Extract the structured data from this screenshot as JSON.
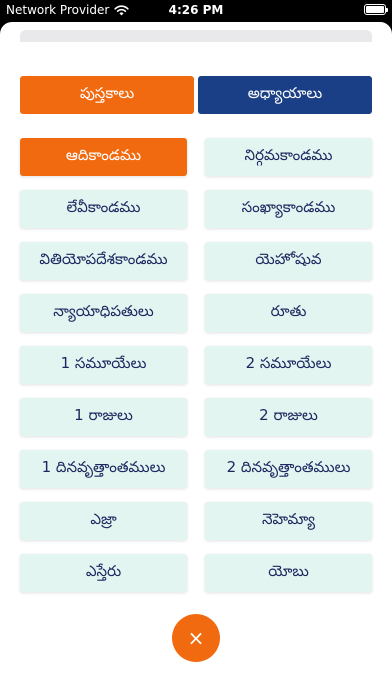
{
  "status_bar": {
    "carrier": "Network Provider",
    "time": "4:26 PM",
    "wifi_icon": "wifi-icon",
    "battery_icon": "battery-icon",
    "battery_level": 1.0
  },
  "tabs": {
    "books_label": "పుస్తకాలు",
    "chapters_label": "అధ్యాయాలు",
    "active": "books"
  },
  "books": [
    {
      "name": "ఆదికాండము",
      "selected": true
    },
    {
      "name": "నిర్గమకాండము",
      "selected": false
    },
    {
      "name": "లేవీకాండము",
      "selected": false
    },
    {
      "name": "సంఖ్యాకాండము",
      "selected": false
    },
    {
      "name": "వితియోపదేశకాండము",
      "selected": false
    },
    {
      "name": "యెహోషువ",
      "selected": false
    },
    {
      "name": "న్యాయాధిపతులు",
      "selected": false
    },
    {
      "name": "రూతు",
      "selected": false
    },
    {
      "name": "1 సమూయేలు",
      "selected": false
    },
    {
      "name": "2 సమూయేలు",
      "selected": false
    },
    {
      "name": "1 రాజులు",
      "selected": false
    },
    {
      "name": "2 రాజులు",
      "selected": false
    },
    {
      "name": "1 దినవృత్తాంతములు",
      "selected": false
    },
    {
      "name": "2 దినవృత్తాంతములు",
      "selected": false
    },
    {
      "name": "ఎజ్రా",
      "selected": false
    },
    {
      "name": "నెహెమ్యా",
      "selected": false
    },
    {
      "name": "ఎస్తేరు",
      "selected": false
    },
    {
      "name": "యోబు",
      "selected": false
    }
  ],
  "close_button": {
    "glyph": "×",
    "icon": "close-icon"
  },
  "colors": {
    "accent_orange": "#f26a10",
    "navy": "#1b3f86",
    "mint": "#e2f5f1",
    "text_navy": "#1d2860"
  }
}
